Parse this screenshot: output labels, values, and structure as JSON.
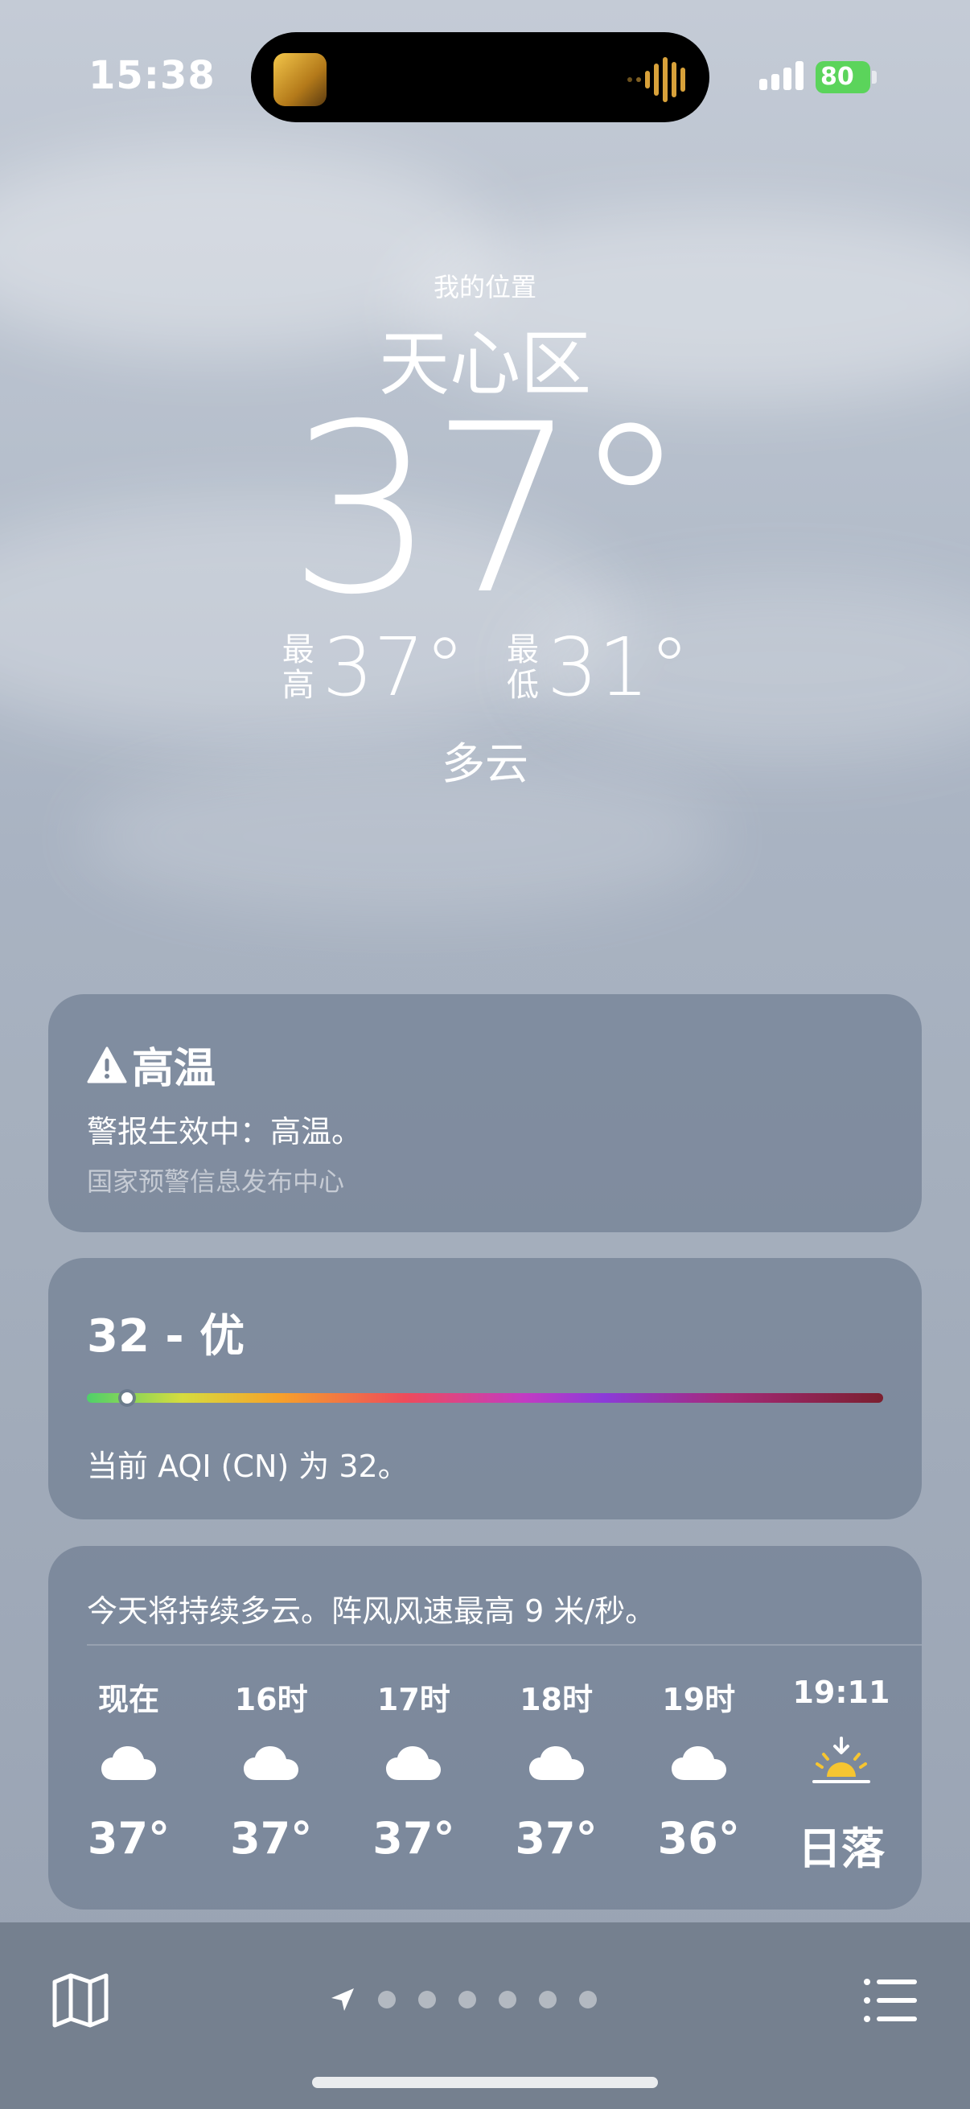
{
  "status_bar": {
    "time": "15:38",
    "battery": "80"
  },
  "header": {
    "location_label": "我的位置",
    "city": "天心区",
    "temperature": "37°",
    "high_label": "最高",
    "high": "37°",
    "low_label": "最低",
    "low": "31°",
    "condition": "多云"
  },
  "alert_card": {
    "title": "高温",
    "message": "警报生效中：高温。",
    "source": "国家预警信息发布中心"
  },
  "aqi_card": {
    "value_label": "32 - 优",
    "level_fraction": 0.05,
    "description": "当前 AQI (CN) 为 32。"
  },
  "hourly_card": {
    "summary": "今天将持续多云。阵风风速最高 9 米/秒。",
    "hours": [
      {
        "label": "现在",
        "icon": "cloud-icon",
        "temp": "37°"
      },
      {
        "label": "16时",
        "icon": "cloud-icon",
        "temp": "37°"
      },
      {
        "label": "17时",
        "icon": "cloud-icon",
        "temp": "37°"
      },
      {
        "label": "18时",
        "icon": "cloud-icon",
        "temp": "37°"
      },
      {
        "label": "19时",
        "icon": "cloud-icon",
        "temp": "36°"
      },
      {
        "label": "19:11",
        "icon": "sunset-icon",
        "temp": "日落"
      }
    ]
  },
  "bottom_bar": {
    "page_count": 7
  },
  "colors": {
    "battery": "#5bd45b",
    "sun": "#f6c531"
  }
}
